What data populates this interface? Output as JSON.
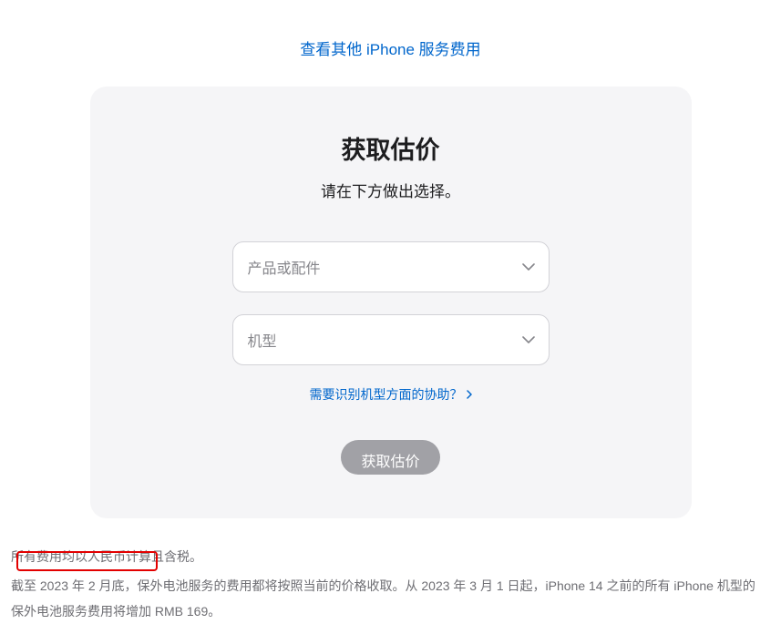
{
  "topLink": {
    "label": "查看其他 iPhone 服务费用"
  },
  "card": {
    "title": "获取估价",
    "subtitle": "请在下方做出选择。",
    "select1": {
      "placeholder": "产品或配件"
    },
    "select2": {
      "placeholder": "机型"
    },
    "helpLink": {
      "label": "需要识别机型方面的协助？"
    },
    "submit": {
      "label": "获取估价"
    }
  },
  "footer": {
    "line1": "所有费用均以人民币计算且含税。",
    "line2_part1": "截至 2023 年 2 月底，保外电池服务的费用都将按照当前的价格收取。从 2023 年 3 月 1 日起，iPhone 14 之前的所有 iPhone 机型的保外电池服务",
    "line2_part2": "费用将增加 RMB 169。"
  }
}
